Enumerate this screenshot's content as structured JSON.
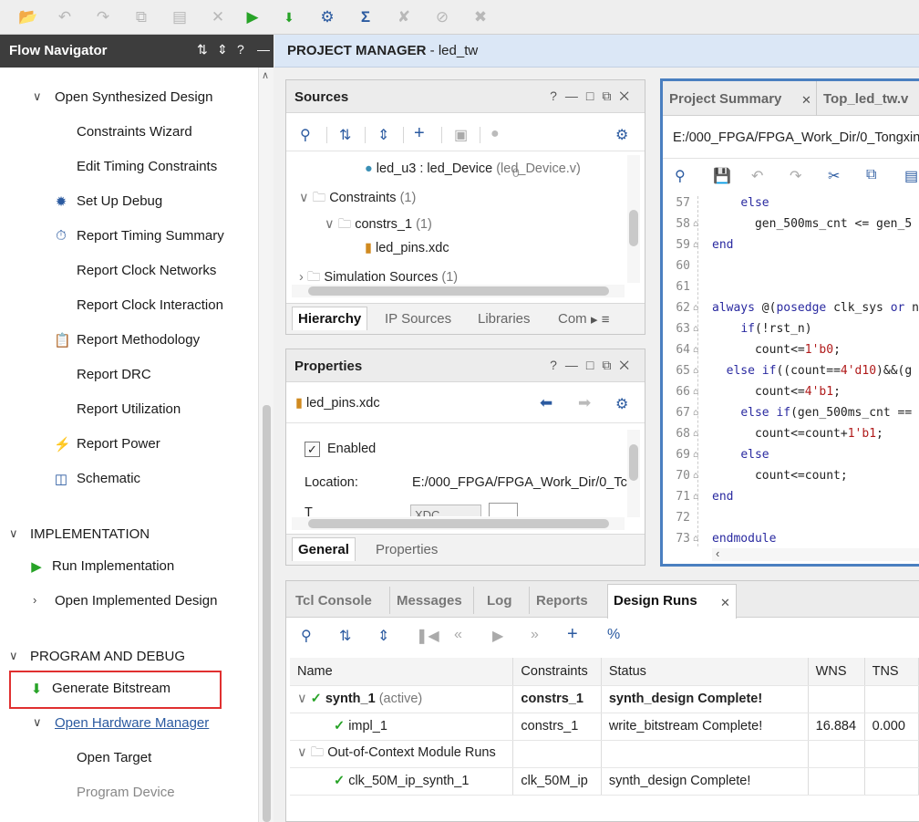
{
  "toolbar": {
    "buttons": [
      "open-project-icon",
      "undo-icon",
      "redo-icon",
      "copy-icon",
      "paste-icon",
      "delete-icon",
      "run-icon",
      "generate-bitstream-icon",
      "settings-icon",
      "sigma-icon",
      "cancel-icon",
      "disable-icon",
      "stop-icon"
    ]
  },
  "flow_navigator": {
    "title": "Flow Navigator",
    "items": {
      "open_synth": "Open Synthesized Design",
      "constraints_wizard": "Constraints Wizard",
      "edit_timing": "Edit Timing Constraints",
      "setup_debug": "Set Up Debug",
      "report_timing": "Report Timing Summary",
      "report_clock_networks": "Report Clock Networks",
      "report_clock_interaction": "Report Clock Interaction",
      "report_methodology": "Report Methodology",
      "report_drc": "Report DRC",
      "report_utilization": "Report Utilization",
      "report_power": "Report Power",
      "schematic": "Schematic",
      "implementation": "IMPLEMENTATION",
      "run_impl": "Run Implementation",
      "open_impl": "Open Implemented Design",
      "program_debug": "PROGRAM AND DEBUG",
      "gen_bitstream": "Generate Bitstream",
      "open_hw": "Open Hardware Manager",
      "open_target": "Open Target",
      "program_device": "Program Device"
    }
  },
  "project_manager": {
    "label": "PROJECT MANAGER",
    "project": " - led_tw"
  },
  "sources": {
    "title": "Sources",
    "count": "0",
    "tree": {
      "u3_name": "led_u3 : led_Device",
      "u3_file": "(led_Device.v)",
      "constraints": "Constraints",
      "constraints_count": "(1)",
      "constrs": "constrs_1",
      "constrs_count": "(1)",
      "xdc": "led_pins.xdc",
      "sim": "Simulation Sources",
      "sim_count": "(1)"
    },
    "tabs": [
      "Hierarchy",
      "IP Sources",
      "Libraries",
      "Com"
    ]
  },
  "properties": {
    "title": "Properties",
    "file": "led_pins.xdc",
    "enabled_label": "Enabled",
    "location_label": "Location:",
    "location_value": "E:/000_FPGA/FPGA_Work_Dir/0_Tc",
    "type_label": "T",
    "type_value": "XDC",
    "tabs": [
      "General",
      "Properties"
    ]
  },
  "editor": {
    "tabs": [
      "Project Summary",
      "Top_led_tw.v"
    ],
    "path": "E:/000_FPGA/FPGA_Work_Dir/0_Tongxin",
    "lines": [
      {
        "n": "57",
        "text": "    else"
      },
      {
        "n": "58",
        "text": "      gen_500ms_cnt <= gen_5"
      },
      {
        "n": "59",
        "text": "end"
      },
      {
        "n": "60",
        "text": ""
      },
      {
        "n": "61",
        "text": ""
      },
      {
        "n": "62",
        "text": "always @(posedge clk_sys or n"
      },
      {
        "n": "63",
        "text": "    if(!rst_n)"
      },
      {
        "n": "64",
        "text": "      count<=1'b0;"
      },
      {
        "n": "65",
        "text": "  else if((count==4'd10)&&(g"
      },
      {
        "n": "66",
        "text": "      count<=4'b1;"
      },
      {
        "n": "67",
        "text": "    else if(gen_500ms_cnt =="
      },
      {
        "n": "68",
        "text": "      count<=count+1'b1;"
      },
      {
        "n": "69",
        "text": "    else"
      },
      {
        "n": "70",
        "text": "      count<=count;"
      },
      {
        "n": "71",
        "text": "end"
      },
      {
        "n": "72",
        "text": ""
      },
      {
        "n": "73",
        "text": "endmodule"
      }
    ]
  },
  "bottom": {
    "tabs": [
      "Tcl Console",
      "Messages",
      "Log",
      "Reports",
      "Design Runs"
    ],
    "columns": [
      "Name",
      "Constraints",
      "Status",
      "WNS",
      "TNS"
    ],
    "rows": [
      {
        "name": "synth_1",
        "extra": "(active)",
        "constraints": "constrs_1",
        "status": "synth_design Complete!",
        "wns": "",
        "tns": ""
      },
      {
        "name": "impl_1",
        "extra": "",
        "constraints": "constrs_1",
        "status": "write_bitstream Complete!",
        "wns": "16.884",
        "tns": "0.000"
      },
      {
        "name": "Out-of-Context Module Runs",
        "extra": "",
        "constraints": "",
        "status": "",
        "wns": "",
        "tns": ""
      },
      {
        "name": "clk_50M_ip_synth_1",
        "extra": "",
        "constraints": "clk_50M_ip",
        "status": "synth_design Complete!",
        "wns": "",
        "tns": ""
      }
    ]
  },
  "colors": {
    "accent_blue": "#2b5aa0",
    "run_green": "#27a327",
    "highlight_red": "#e03030"
  }
}
